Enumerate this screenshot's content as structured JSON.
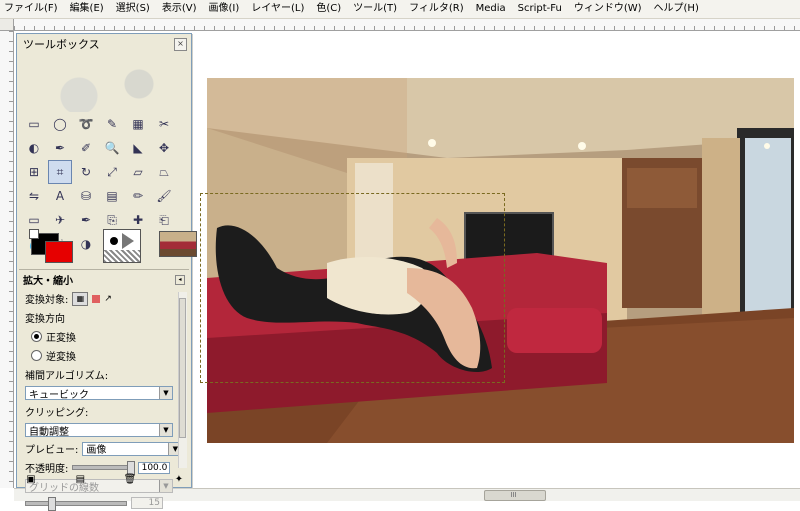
{
  "menu": [
    "ファイル(F)",
    "編集(E)",
    "選択(S)",
    "表示(V)",
    "画像(I)",
    "レイヤー(L)",
    "色(C)",
    "ツール(T)",
    "フィルタ(R)",
    "Media",
    "Script-Fu",
    "ウィンドウ(W)",
    "ヘルプ(H)"
  ],
  "toolbox": {
    "title": "ツールボックス",
    "tools": [
      "rect-select-icon",
      "ellipse-select-icon",
      "lasso-icon",
      "magic-wand-icon",
      "color-select-icon",
      "scissors-icon",
      "foreground-select-icon",
      "paths-icon",
      "color-picker-icon",
      "zoom-icon",
      "measure-icon",
      "move-icon",
      "align-icon",
      "crop-icon",
      "rotate-icon",
      "scale-icon",
      "shear-icon",
      "perspective-icon",
      "flip-icon",
      "text-icon",
      "bucket-fill-icon",
      "blend-icon",
      "pencil-icon",
      "paintbrush-icon",
      "eraser-icon",
      "airbrush-icon",
      "ink-icon",
      "clone-icon",
      "heal-icon",
      "perspective-clone-icon",
      "blur-icon",
      "smudge-icon",
      "dodge-burn-icon"
    ],
    "active_tool_index": 13
  },
  "tool_options": {
    "header": "拡大・縮小",
    "transform_label": "変換対象:",
    "direction_label": "変換方向",
    "direction_options": [
      "正変換",
      "逆変換"
    ],
    "interpolation_label": "補間アルゴリズム:",
    "interpolation_value": "キュービック",
    "clipping_label": "クリッピング:",
    "clipping_value": "自動調整",
    "preview_label": "プレビュー:",
    "preview_value": "画像",
    "opacity_label": "不透明度:",
    "opacity_value": "100.0",
    "grid_label": "グリッドの線数",
    "grid_value": "15"
  },
  "icons": {
    "colors": {
      "fg": "#000000",
      "bg": "#e60000"
    }
  }
}
